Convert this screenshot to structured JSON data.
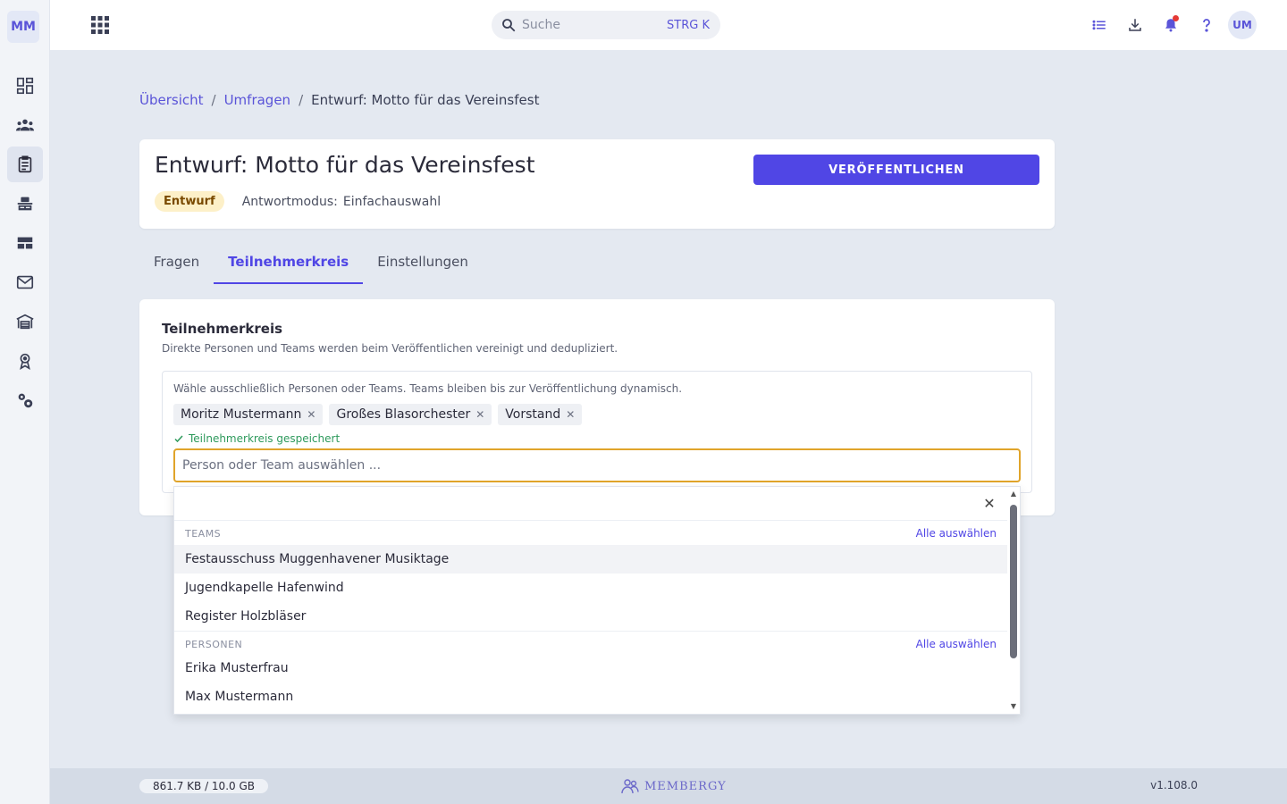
{
  "sidebar": {
    "logo": "MM",
    "items": [
      {
        "name": "dashboard",
        "icon": "dashboard-icon"
      },
      {
        "name": "members",
        "icon": "people-icon"
      },
      {
        "name": "surveys",
        "icon": "clipboard-icon",
        "active": true
      },
      {
        "name": "inventory",
        "icon": "desk-icon"
      },
      {
        "name": "layout",
        "icon": "layout-icon"
      },
      {
        "name": "mail",
        "icon": "mail-icon"
      },
      {
        "name": "warehouse",
        "icon": "warehouse-icon"
      },
      {
        "name": "awards",
        "icon": "medal-icon"
      },
      {
        "name": "settings",
        "icon": "gear-icon"
      }
    ]
  },
  "topbar": {
    "search_placeholder": "Suche",
    "search_shortcut": "STRG K",
    "avatar": "UM",
    "icons": [
      "list-icon",
      "download-icon",
      "bell-icon",
      "help-icon"
    ]
  },
  "breadcrumb": {
    "items": [
      "Übersicht",
      "Umfragen"
    ],
    "current": "Entwurf: Motto für das Vereinsfest",
    "separator": "/"
  },
  "header": {
    "title": "Entwurf: Motto für das Vereinsfest",
    "status": "Entwurf",
    "mode_label": "Antwortmodus:",
    "mode_value": "Einfachauswahl",
    "publish_label": "VERÖFFENTLICHEN"
  },
  "tabs": [
    {
      "label": "Fragen",
      "active": false
    },
    {
      "label": "Teilnehmerkreis",
      "active": true
    },
    {
      "label": "Einstellungen",
      "active": false
    }
  ],
  "participants": {
    "title": "Teilnehmerkreis",
    "description": "Direkte Personen und Teams werden beim Veröffentlichen vereinigt und dedupliziert.",
    "hint": "Wähle ausschließlich Personen oder Teams. Teams bleiben bis zur Veröffentlichung dynamisch.",
    "chips": [
      "Moritz Mustermann",
      "Großes Blasorchester",
      "Vorstand"
    ],
    "saved_message": "Teilnehmerkreis gespeichert",
    "input_placeholder": "Person oder Team auswählen ..."
  },
  "dropdown": {
    "groups": [
      {
        "label": "TEAMS",
        "select_all": "Alle auswählen",
        "options": [
          "Festausschuss Muggenhavener Musiktage",
          "Jugendkapelle Hafenwind",
          "Register Holzbläser"
        ]
      },
      {
        "label": "PERSONEN",
        "select_all": "Alle auswählen",
        "options": [
          "Erika Musterfrau",
          "Max Mustermann"
        ]
      }
    ]
  },
  "footer": {
    "storage": "861.7 KB / 10.0 GB",
    "brand": "MEMBERGY",
    "version": "v1.108.0"
  },
  "colors": {
    "accent": "#5046e5",
    "draft_badge_bg": "#fdf0c8",
    "focus_border": "#e0a42a",
    "success": "#2e9a5c"
  }
}
